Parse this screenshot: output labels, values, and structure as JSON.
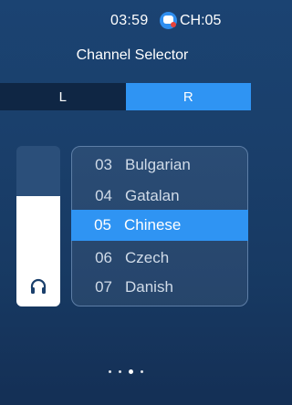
{
  "status": {
    "time": "03:59",
    "channel_label": "CH:05"
  },
  "title": "Channel Selector",
  "tabs": [
    {
      "label": "L",
      "selected": false
    },
    {
      "label": "R",
      "selected": true
    }
  ],
  "volume": {
    "level": 0.69,
    "icon": "headphone-icon"
  },
  "channels": [
    {
      "num": "03",
      "name": "Bulgarian",
      "selected": false
    },
    {
      "num": "04",
      "name": "Gatalan",
      "selected": false
    },
    {
      "num": "05",
      "name": "Chinese",
      "selected": true
    },
    {
      "num": "06",
      "name": "Czech",
      "selected": false
    },
    {
      "num": "07",
      "name": "Danish",
      "selected": false
    }
  ],
  "pagination": {
    "count": 4,
    "active_index": 2
  },
  "colors": {
    "accent": "#2f94f3",
    "background": "#1a3f6b",
    "tab_inactive": "#0f2644"
  }
}
